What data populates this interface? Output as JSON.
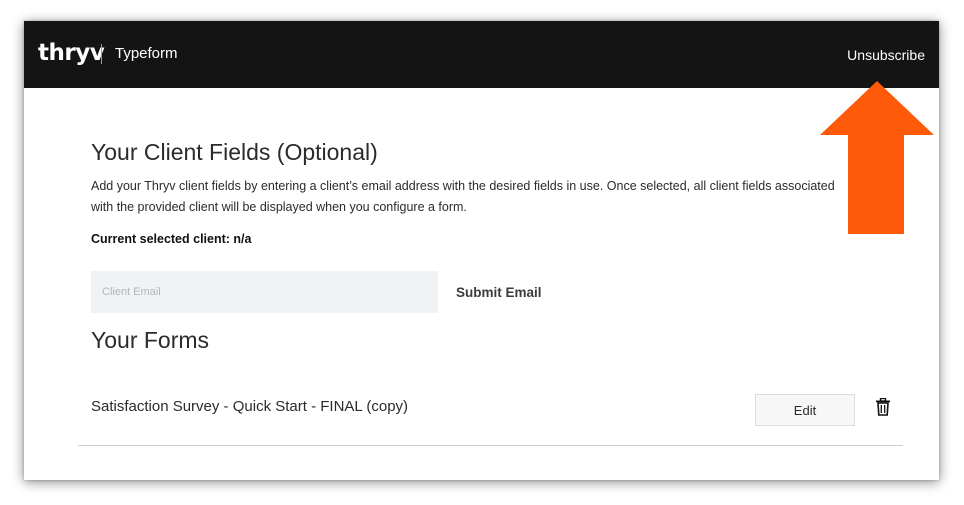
{
  "header": {
    "logo_text": "thryv",
    "app_name": "Typeform",
    "unsubscribe_label": "Unsubscribe"
  },
  "client_fields": {
    "title": "Your Client Fields (Optional)",
    "description": "Add your Thryv client fields by entering a client’s email address with the desired fields in use. Once selected, all client fields associated with the provided client will be displayed when you configure a form.",
    "current_client_label": "Current selected client: n/a",
    "email_placeholder": "Client Email",
    "email_value": "",
    "submit_label": "Submit Email"
  },
  "forms": {
    "title": "Your Forms",
    "items": [
      {
        "name": "Satisfaction Survey - Quick Start - FINAL (copy)",
        "edit_label": "Edit",
        "delete_icon": "trash-icon"
      }
    ]
  },
  "annotation": {
    "arrow_color": "#ff5a0a",
    "arrow_icon": "up-arrow"
  },
  "colors": {
    "header_bg": "#141414",
    "input_bg": "#f0f2f3"
  }
}
